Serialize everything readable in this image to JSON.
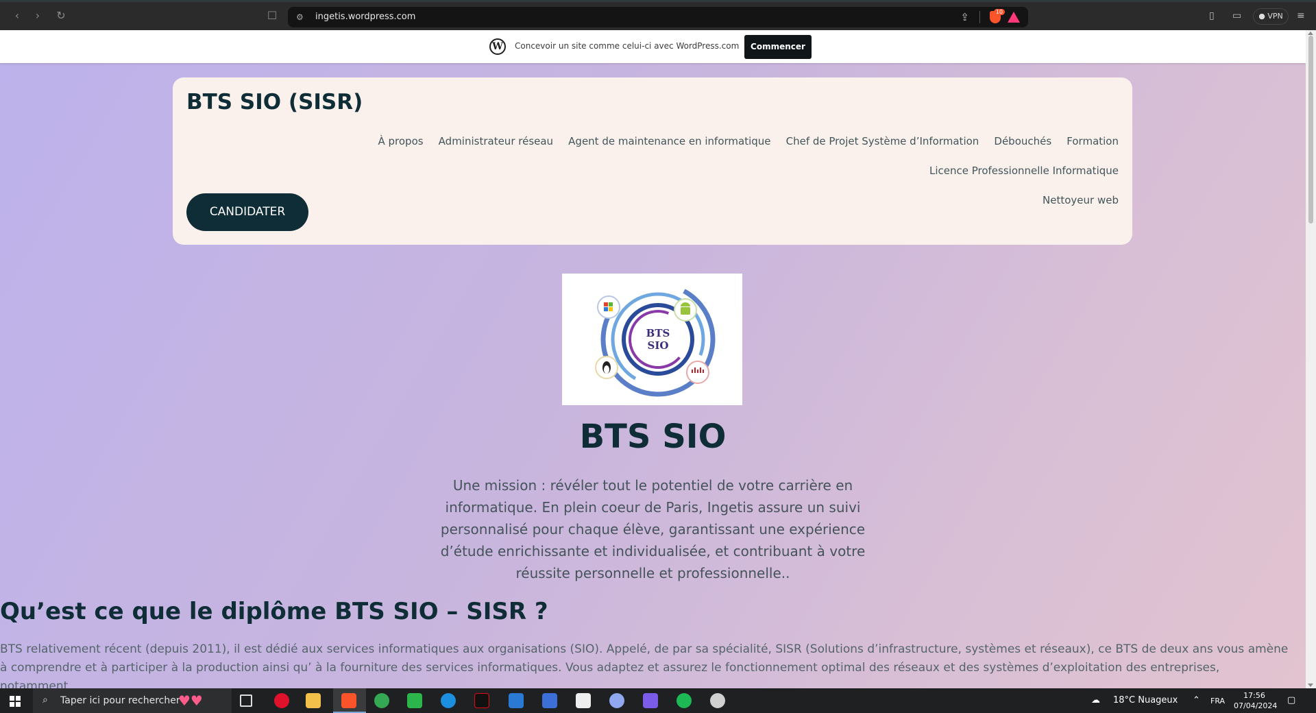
{
  "browser": {
    "url": "ingetis.wordpress.com",
    "vpn_label": "VPN",
    "brave_badge": "10"
  },
  "wp_banner": {
    "text": "Concevoir un site comme celui-ci avec WordPress.com",
    "button": "Commencer"
  },
  "site": {
    "title": "BTS SIO (SISR)",
    "nav": [
      "À propos",
      "Administrateur réseau",
      "Agent de maintenance en informatique",
      "Chef de Projet Système d’Information",
      "Débouchés",
      "Formation",
      "Licence Professionnelle Informatique",
      "Nettoyeur web"
    ],
    "cta": "CANDIDATER"
  },
  "logo": {
    "line1": "BTS",
    "line2": "SIO"
  },
  "hero": {
    "title": "BTS SIO",
    "mission": "Une mission : révéler tout le potentiel de votre carrière en informatique. En plein coeur de Paris, Ingetis assure un suivi personnalisé pour chaque élève, garantissant une expérience d’étude enrichissante et individualisée, et contribuant à votre réussite personnelle et professionnelle.."
  },
  "section": {
    "title": "Qu’est ce que le diplôme BTS SIO – SISR ?",
    "body": "BTS relativement récent (depuis 2011), il est dédié aux services informatiques aux organisations (SIO). Appelé, de par sa spécialité, SISR (Solutions d’infrastructure, systèmes et réseaux), ce BTS de deux ans vous amène à comprendre et à participer à la production ainsi qu’ à la fourniture des services informatiques. Vous adaptez et assurez le fonctionnement optimal des réseaux et des systèmes d’exploitation des entreprises, notamment."
  },
  "taskbar": {
    "search_placeholder": "Taper ici pour rechercher",
    "weather": "18°C  Nuageux",
    "language": "FRA",
    "time": "17:56",
    "date": "07/04/2024"
  }
}
